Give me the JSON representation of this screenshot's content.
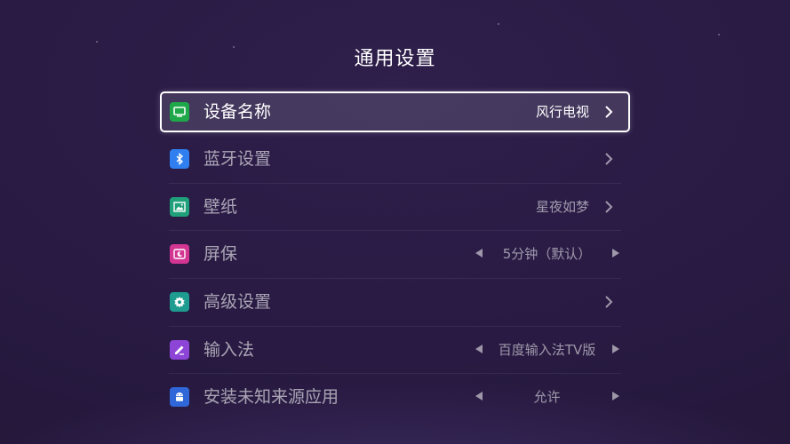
{
  "page": {
    "title": "通用设置"
  },
  "menu": {
    "items": [
      {
        "label": "设备名称",
        "value": "风行电视",
        "icon": "tv-icon",
        "color": "#1fa84a",
        "control": "chevron",
        "focused": true
      },
      {
        "label": "蓝牙设置",
        "value": "",
        "icon": "bluetooth-icon",
        "color": "#2f7ff0",
        "control": "chevron",
        "focused": false
      },
      {
        "label": "壁纸",
        "value": "星夜如梦",
        "icon": "image-icon",
        "color": "#1fa07a",
        "control": "chevron",
        "focused": false
      },
      {
        "label": "屏保",
        "value": "5分钟（默认）",
        "icon": "screensaver-icon",
        "color": "#d23592",
        "control": "spinner",
        "focused": false
      },
      {
        "label": "高级设置",
        "value": "",
        "icon": "gear-icon",
        "color": "#1e9c8f",
        "control": "chevron",
        "focused": false
      },
      {
        "label": "输入法",
        "value": "百度输入法TV版",
        "icon": "pen-icon",
        "color": "#8c45d6",
        "control": "spinner",
        "focused": false
      },
      {
        "label": "安装未知来源应用",
        "value": "允许",
        "icon": "android-icon",
        "color": "#2f67d8",
        "control": "spinner",
        "focused": false
      }
    ]
  }
}
